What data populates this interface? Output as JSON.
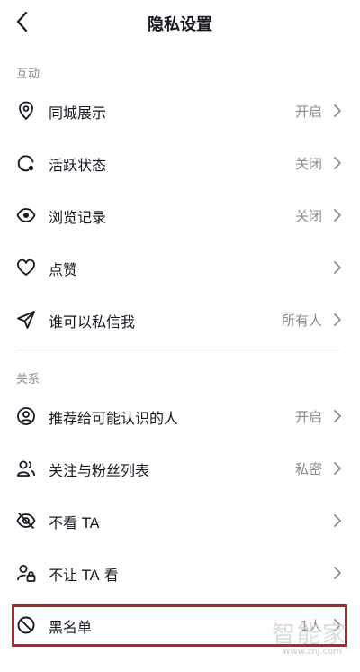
{
  "header": {
    "title": "隐私设置"
  },
  "sections": [
    {
      "label": "互动"
    },
    {
      "label": "关系"
    }
  ],
  "rows": [
    {
      "label": "同城展示",
      "value": "开启",
      "icon": "location-pin-icon"
    },
    {
      "label": "活跃状态",
      "value": "关闭",
      "icon": "active-status-icon"
    },
    {
      "label": "浏览记录",
      "value": "关闭",
      "icon": "eye-icon"
    },
    {
      "label": "点赞",
      "value": "",
      "icon": "heart-icon"
    },
    {
      "label": "谁可以私信我",
      "value": "所有人",
      "icon": "send-icon"
    },
    {
      "label": "推荐给可能认识的人",
      "value": "开启",
      "icon": "user-circle-icon"
    },
    {
      "label": "关注与粉丝列表",
      "value": "私密",
      "icon": "users-icon"
    },
    {
      "label": "不看 TA",
      "value": "",
      "icon": "eye-off-icon"
    },
    {
      "label": "不让 TA 看",
      "value": "",
      "icon": "user-lock-icon"
    },
    {
      "label": "黑名单",
      "value": "1人",
      "icon": "block-icon"
    }
  ],
  "watermark": {
    "text": "智能家",
    "url": "www.znj.com"
  },
  "colors": {
    "highlight": "#b52524",
    "text": "#161823",
    "secondary": "#8a8b91"
  }
}
